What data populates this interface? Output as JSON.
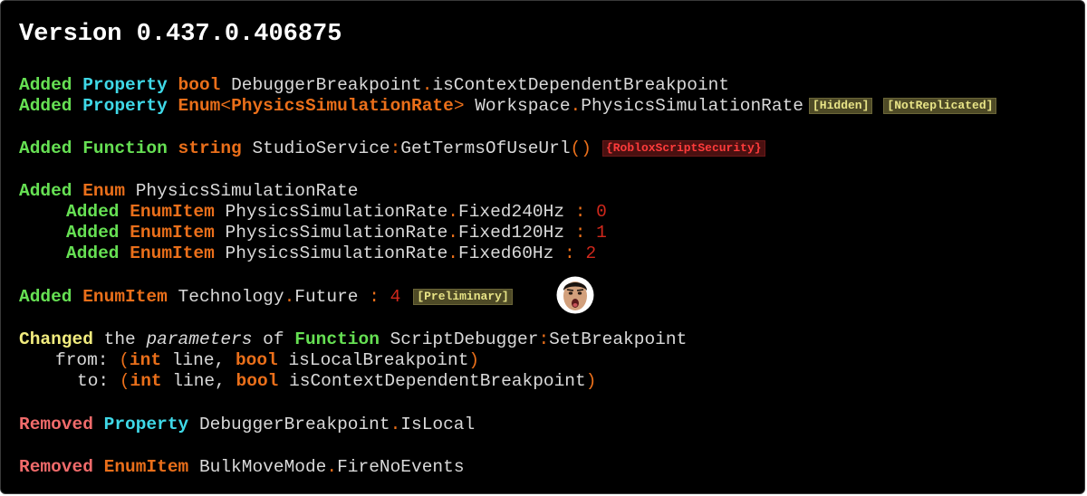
{
  "title": "Version 0.437.0.406875",
  "added_kw": "Added",
  "changed_kw": "Changed",
  "removed_kw": "Removed",
  "l1": {
    "kind": "Property",
    "type": "bool",
    "class": "DebuggerBreakpoint",
    "sep": ".",
    "member": "isContextDependentBreakpoint"
  },
  "l2": {
    "kind": "Property",
    "type_a": "Enum",
    "lt": "<",
    "type_b": "PhysicsSimulationRate",
    "gt": ">",
    "class": "Workspace",
    "sep": ".",
    "member": "PhysicsSimulationRate",
    "tags": [
      "[Hidden]",
      "[NotReplicated]"
    ]
  },
  "l3": {
    "kind": "Function",
    "type": "string",
    "class": "StudioService",
    "sep": ":",
    "member": "GetTermsOfUseUrl",
    "parens": "()",
    "tag": "{RobloxScriptSecurity}"
  },
  "l4": {
    "kind": "Enum",
    "name": "PhysicsSimulationRate"
  },
  "enum_items": [
    {
      "kind": "EnumItem",
      "class": "PhysicsSimulationRate",
      "sep": ".",
      "member": "Fixed240Hz",
      "colon": ":",
      "value": "0"
    },
    {
      "kind": "EnumItem",
      "class": "PhysicsSimulationRate",
      "sep": ".",
      "member": "Fixed120Hz",
      "colon": ":",
      "value": "1"
    },
    {
      "kind": "EnumItem",
      "class": "PhysicsSimulationRate",
      "sep": ".",
      "member": "Fixed60Hz",
      "colon": ":",
      "value": "2"
    }
  ],
  "l8": {
    "kind": "EnumItem",
    "class": "Technology",
    "sep": ".",
    "member": "Future",
    "colon": ":",
    "value": "4",
    "tag": "[Preliminary]",
    "emoji": "shocked-face-emoji"
  },
  "l9": {
    "the": "the",
    "params": "parameters",
    "of": "of",
    "kind": "Function",
    "class": "ScriptDebugger",
    "sep": ":",
    "member": "SetBreakpoint"
  },
  "from": {
    "label": "from:",
    "open": "(",
    "t1": "int",
    "n1": "line,",
    "t2": "bool",
    "n2": "isLocalBreakpoint",
    "close": ")"
  },
  "to": {
    "label": "to:",
    "open": "(",
    "t1": "int",
    "n1": "line,",
    "t2": "bool",
    "n2": "isContextDependentBreakpoint",
    "close": ")"
  },
  "r1": {
    "kind": "Property",
    "class": "DebuggerBreakpoint",
    "sep": ".",
    "member": "IsLocal"
  },
  "r2": {
    "kind": "EnumItem",
    "class": "BulkMoveMode",
    "sep": ".",
    "member": "FireNoEvents"
  },
  "colors": {
    "background": "#000000",
    "added": "#66e053",
    "property": "#3fd9e8",
    "type": "#ea6f1a",
    "changed": "#f2ec7e",
    "removed": "#f06b6b",
    "number": "#d0281c",
    "tag_bg": "#4e4a26",
    "security_tag": "#ff3b3b"
  }
}
